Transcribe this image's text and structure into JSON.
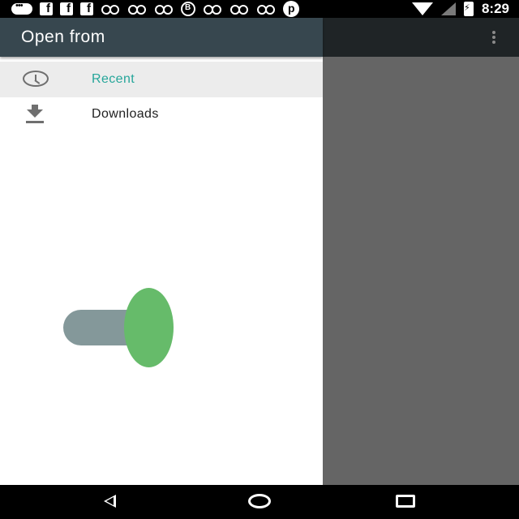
{
  "status_bar": {
    "time": "8:29",
    "left_icons": [
      "chat-bubble-icon",
      "facebook-icon",
      "facebook-icon",
      "facebook-icon",
      "loop-icon",
      "loop-icon",
      "loop-icon",
      "b-circle-icon",
      "loop-icon",
      "loop-icon",
      "loop-icon",
      "pinterest-icon"
    ],
    "right_icons": [
      "wifi-icon",
      "signal-icon",
      "battery-charging-icon"
    ]
  },
  "drawer": {
    "title": "Open from",
    "items": [
      {
        "label": "Recent",
        "icon": "clock-icon",
        "selected": true
      },
      {
        "label": "Downloads",
        "icon": "download-icon",
        "selected": false
      }
    ]
  },
  "toolbar": {
    "overflow_icon": "overflow-menu-icon"
  },
  "colors": {
    "drawer_header": "#37474f",
    "accent": "#26a69a",
    "scrim": "#656565",
    "illustration_green": "#66bb6a",
    "illustration_gray": "#84989a"
  },
  "nav_bar": {
    "buttons": [
      "back-icon",
      "home-icon",
      "recents-icon"
    ]
  }
}
